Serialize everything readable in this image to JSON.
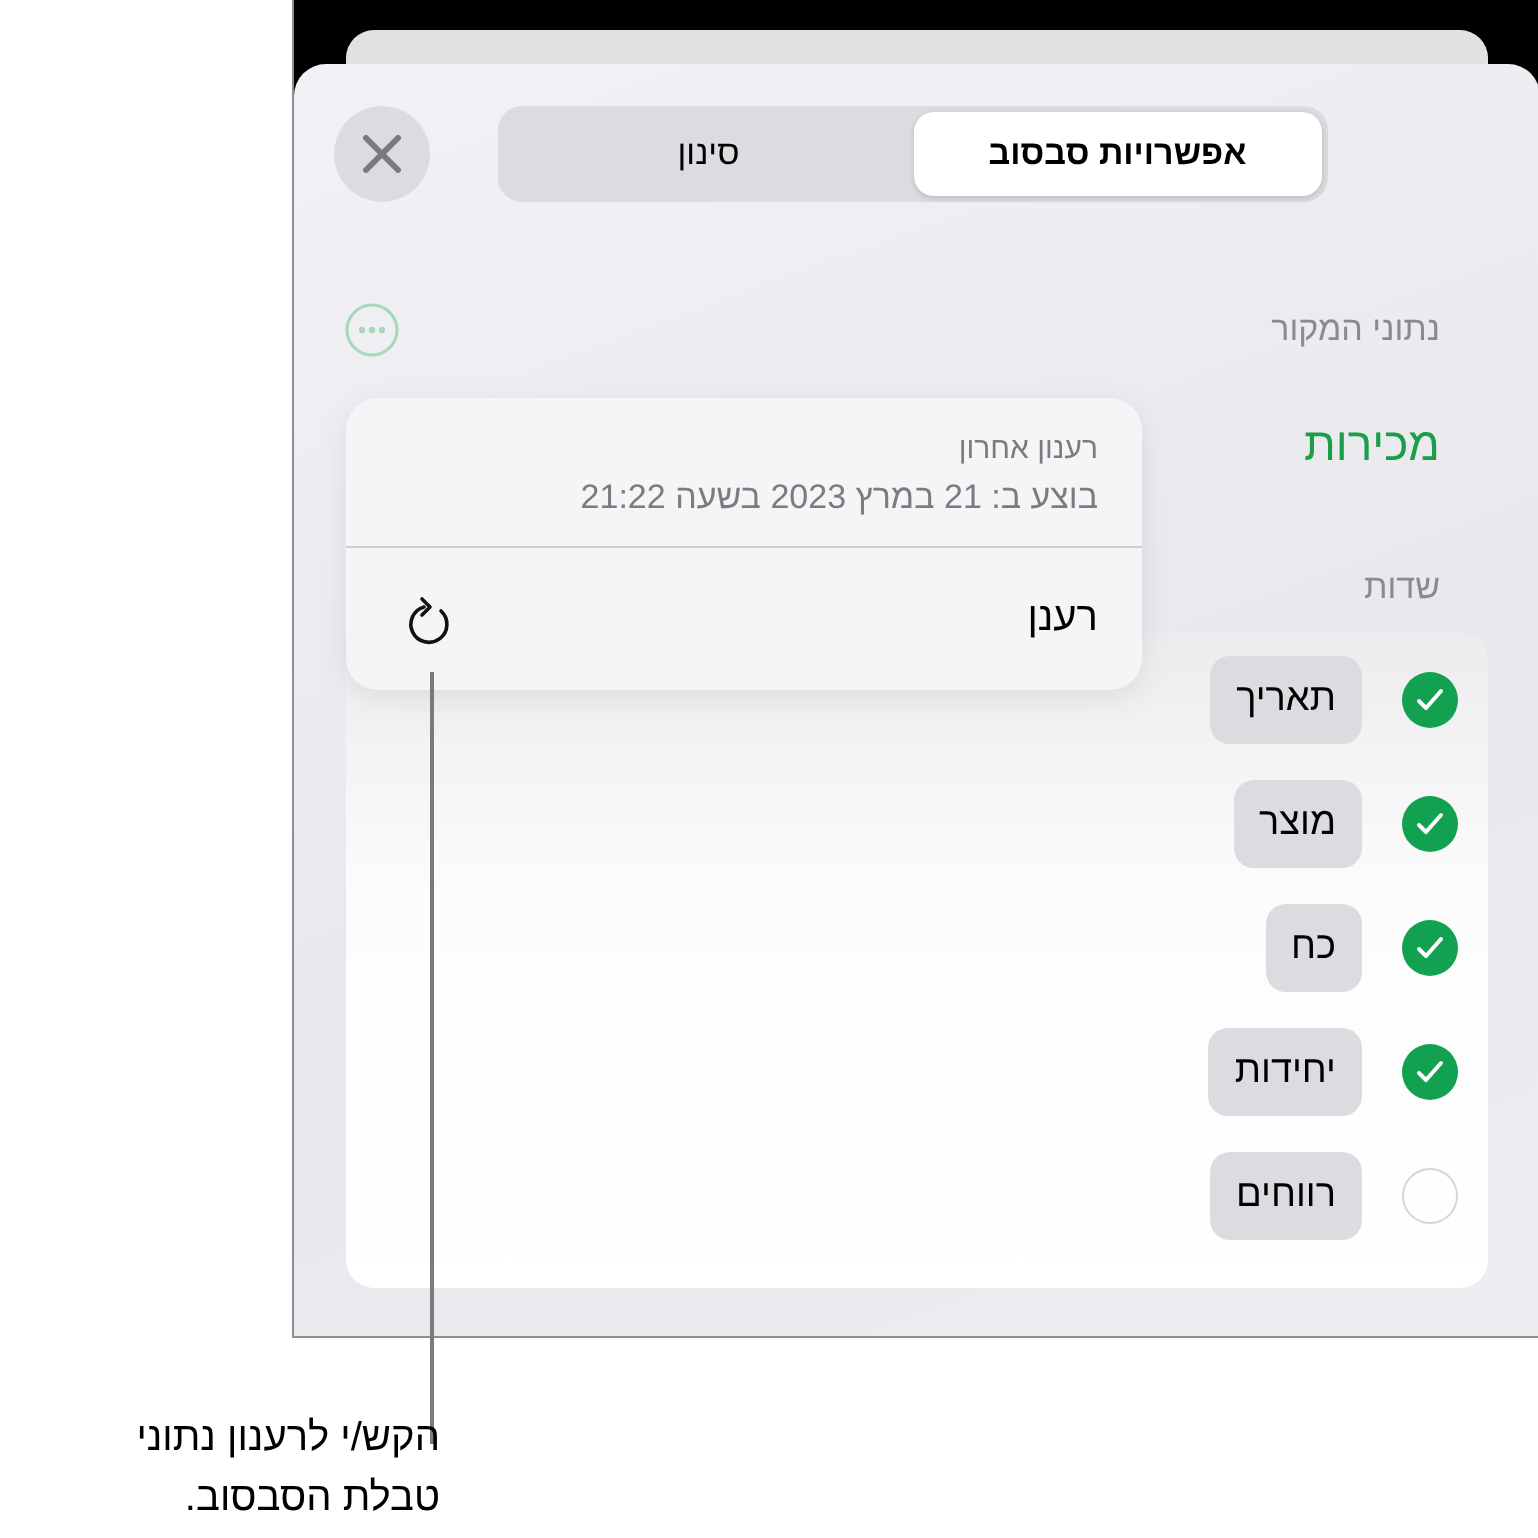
{
  "tabs": [
    {
      "label": "אפשרויות סבסוב",
      "selected": true
    },
    {
      "label": "סינון",
      "selected": false
    }
  ],
  "source": {
    "label": "נתוני המקור",
    "name": "מכירות"
  },
  "fields": {
    "label": "שדות",
    "items": [
      {
        "name": "תאריך",
        "checked": true
      },
      {
        "name": "מוצר",
        "checked": true
      },
      {
        "name": "כח",
        "checked": true
      },
      {
        "name": "יחידות",
        "checked": true
      },
      {
        "name": "רווחים",
        "checked": false
      }
    ]
  },
  "popover": {
    "title": "רענון אחרון",
    "detail": "בוצע ב: 21 במרץ 2023 בשעה 21:22",
    "action": "רענן"
  },
  "callout": {
    "lines": [
      "הקש/י לרענון נתוני",
      "טבלת הסבסוב."
    ]
  }
}
